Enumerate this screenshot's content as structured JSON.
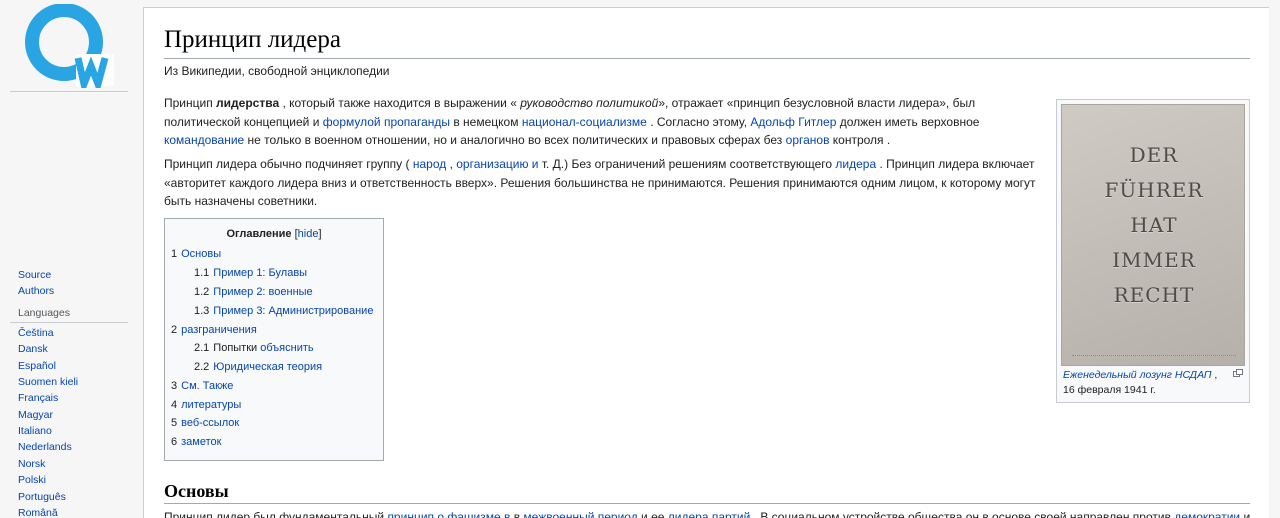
{
  "sidebar": {
    "logo_name": "site-logo",
    "tools": [
      {
        "label": "Source"
      },
      {
        "label": "Authors"
      }
    ],
    "languages_heading": "Languages",
    "languages": [
      "Čeština",
      "Dansk",
      "Español",
      "Suomen kieli",
      "Français",
      "Magyar",
      "Italiano",
      "Nederlands",
      "Norsk",
      "Polski",
      "Português",
      "Română"
    ]
  },
  "article": {
    "title": "Принцип лидера",
    "tagline": "Из Википедии, свободной энциклопедии",
    "p1": {
      "s1": "Принцип ",
      "b1": "лидерства",
      "s2": " , который также находится в выражении « ",
      "i1": "руководство политикой",
      "s3": "», отражает «принцип безусловной власти лидера», был политической концепцией и ",
      "l1": "формулой пропаганды",
      "s4": " в немецком ",
      "l2": "национал-социализме",
      "s5": " . Согласно этому, ",
      "l3": "Адольф Гитлер",
      "s6": " должен иметь верховное ",
      "l4": "командование",
      "s7": " не только в военном отношении, но и аналогично во всех политических и правовых сферах без ",
      "l5": "органов",
      "s8": " контроля ."
    },
    "p2": {
      "s1": "Принцип лидера обычно подчиняет группу ( ",
      "l1": "народ",
      "s2": " , ",
      "l2": "организацию и",
      "s3": " т. Д.) Без ограничений решениям соответствующего ",
      "l3": "лидера",
      "s4": " . Принцип лидера включает «авторитет каждого лидера вниз и ответственность вверх». Решения большинства не принимаются. Решения принимаются одним лицом, к которому могут быть назначены советники."
    },
    "toc": {
      "title": "Оглавление",
      "bracket_open": " [",
      "hide": "hide",
      "bracket_close": "]",
      "items": [
        {
          "num": "1",
          "label": "Основы"
        },
        {
          "num": "1.1",
          "label": "Пример 1: Булавы"
        },
        {
          "num": "1.2",
          "label": "Пример 2: военные"
        },
        {
          "num": "1.3",
          "label": "Пример 3: Администрирование"
        },
        {
          "num": "2",
          "label": "разграничения"
        },
        {
          "num": "2.1",
          "label_plain": "Попытки ",
          "label": "объяснить"
        },
        {
          "num": "2.2",
          "label": "Юридическая теория"
        },
        {
          "num": "3",
          "label": "См. Также"
        },
        {
          "num": "4",
          "label": "литературы"
        },
        {
          "num": "5",
          "label": "веб-ссылок"
        },
        {
          "num": "6",
          "label": "заметок"
        }
      ]
    },
    "figure": {
      "poster_lines": [
        "DER",
        "FÜHRER",
        "HAT",
        "IMMER",
        "RECHT"
      ],
      "caption_link": "Еженедельный лозунг НСДАП",
      "caption_rest": " ,",
      "caption_date": "16 февраля 1941 г."
    },
    "section": {
      "heading": "Основы",
      "text_1": "Принцип лидер был фундаментальный ",
      "link_1": "принцип о фашизме в",
      "text_2": " в ",
      "link_2": "межвоенный период",
      "text_3": " и ее ",
      "link_3": "лидера партий",
      "text_4": " . В социальном устройстве общества он в основе своей направлен против ",
      "link_4": "демократии",
      "text_5": " и"
    }
  },
  "colors": {
    "link": "#0645ad",
    "logo": "#2aa5e3",
    "border": "#a7d7f9"
  }
}
